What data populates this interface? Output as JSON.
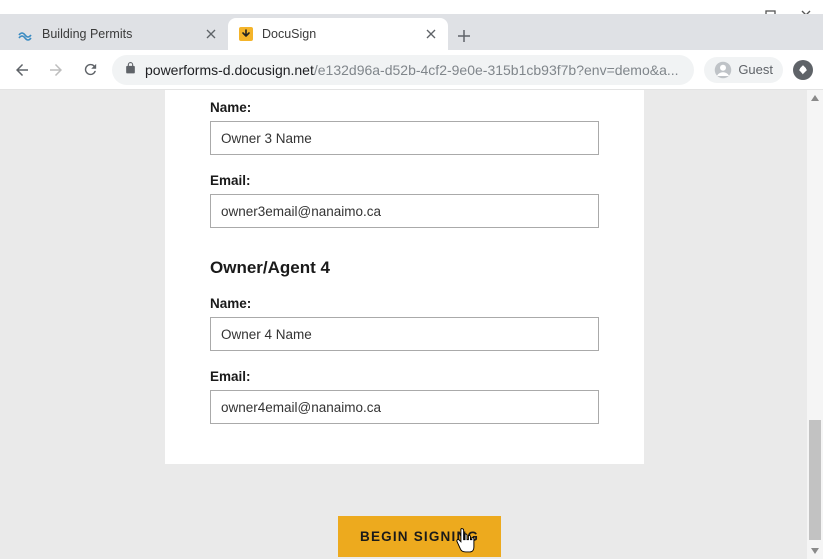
{
  "window": {
    "controls": {
      "min": "window-minimize",
      "max": "window-maximize",
      "close": "window-close"
    }
  },
  "browser": {
    "tabs": [
      {
        "title": "Building Permits",
        "active": false
      },
      {
        "title": "DocuSign",
        "active": true
      }
    ],
    "url_host": "powerforms-d.docusign.net",
    "url_path": "/e132d96a-d52b-4cf2-9e0e-315b1cb93f7b?env=demo&a...",
    "guest_label": "Guest"
  },
  "form": {
    "owner3": {
      "name_label": "Name:",
      "name_value": "Owner 3 Name",
      "email_label": "Email:",
      "email_value": "owner3email@nanaimo.ca"
    },
    "section4_heading": "Owner/Agent 4",
    "owner4": {
      "name_label": "Name:",
      "name_value": "Owner 4 Name",
      "email_label": "Email:",
      "email_value": "owner4email@nanaimo.ca"
    },
    "begin_signing": "BEGIN SIGNING"
  }
}
